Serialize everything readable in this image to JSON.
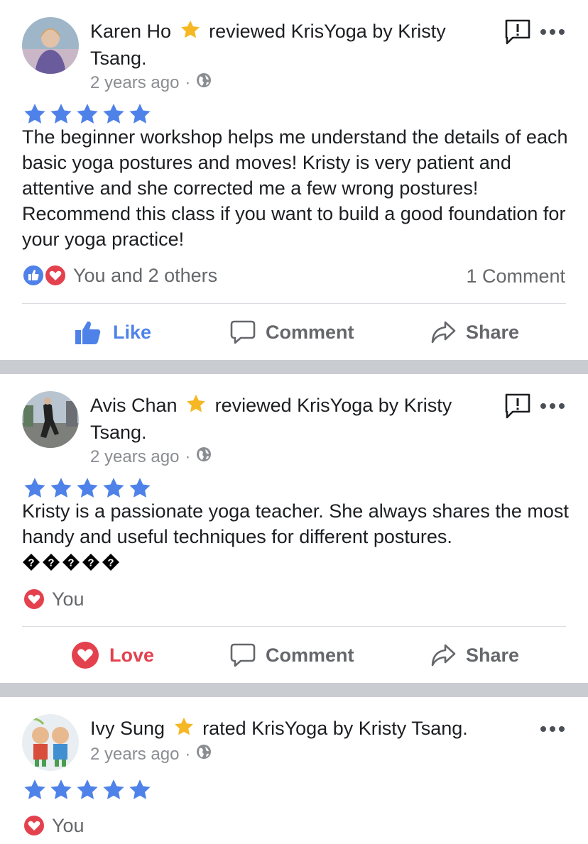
{
  "reviews": [
    {
      "user": "Karen Ho",
      "action_text": "reviewed KrisYoga by Kristy Tsang.",
      "time": "2 years ago",
      "rating": 5,
      "text": "The beginner workshop helps me understand the details of each basic yoga postures and moves! Kristy is very patient and attentive and she corrected me a few wrong postures! Recommend this class if you want to build a good foundation for your yoga practice!",
      "reactions_text": "You and 2 others",
      "comments_text": "1 Comment",
      "reaction_label": "Like",
      "comment_label": "Comment",
      "share_label": "Share"
    },
    {
      "user": "Avis Chan",
      "action_text": "reviewed KrisYoga by Kristy Tsang.",
      "time": "2 years ago",
      "rating": 5,
      "text": "Kristy is a passionate yoga teacher. She always shares the most handy and useful techniques for different postures.",
      "glyphs": [
        "?",
        "?",
        "?",
        "?",
        "?"
      ],
      "reactions_text": "You",
      "reaction_label": "Love",
      "comment_label": "Comment",
      "share_label": "Share"
    },
    {
      "user": "Ivy Sung",
      "action_text": "rated KrisYoga by Kristy Tsang.",
      "time": "2 years ago",
      "rating": 5,
      "reactions_text": "You"
    }
  ],
  "colors": {
    "star_blue": "#4f82e9",
    "badge_gold": "#f5b723",
    "like_blue": "#4f82e9",
    "love_red": "#e4414e",
    "separator": "#c9ccd1"
  },
  "icons": {
    "badge": "star-badge-icon",
    "privacy": "globe-icon",
    "report": "report-icon",
    "more": "more-icon",
    "like": "thumbs-up-icon",
    "love": "heart-icon",
    "comment": "comment-icon",
    "share": "share-icon"
  }
}
